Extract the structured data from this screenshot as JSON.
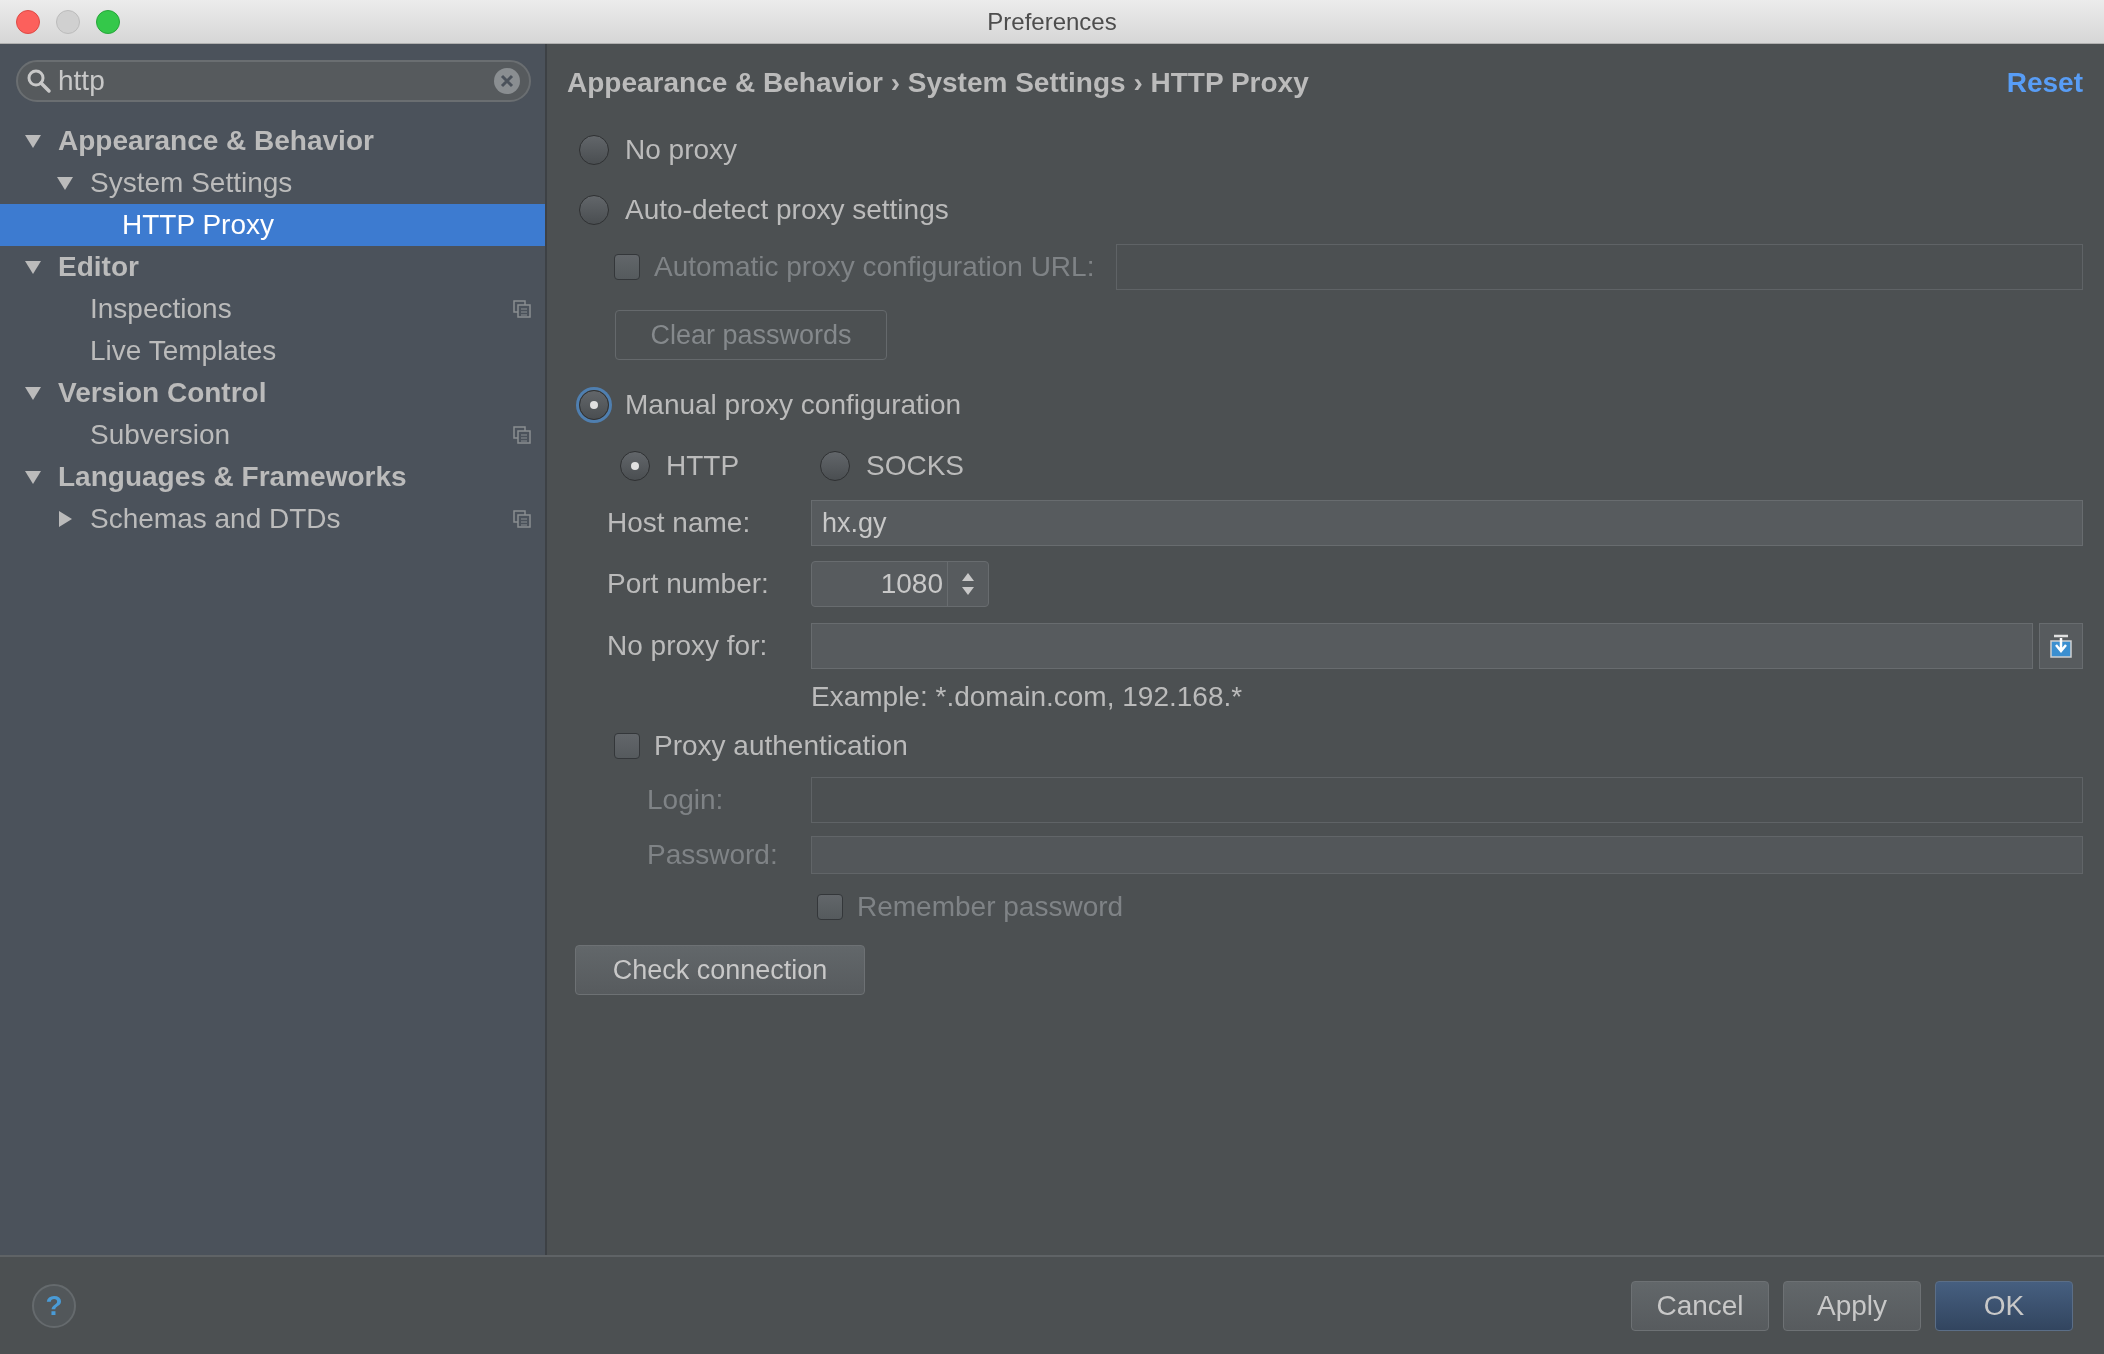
{
  "window": {
    "title": "Preferences"
  },
  "search": {
    "value": "http"
  },
  "tree": [
    {
      "label": "Appearance & Behavior",
      "expanded": true,
      "selected": false,
      "shared": false,
      "children": [
        {
          "label": "System Settings",
          "expanded": true,
          "selected": false,
          "shared": false,
          "children": [
            {
              "label": "HTTP Proxy",
              "selected": true,
              "shared": false
            }
          ]
        }
      ]
    },
    {
      "label": "Editor",
      "expanded": true,
      "selected": false,
      "shared": false,
      "children": [
        {
          "label": "Inspections",
          "selected": false,
          "shared": true
        },
        {
          "label": "Live Templates",
          "selected": false,
          "shared": false
        }
      ]
    },
    {
      "label": "Version Control",
      "expanded": true,
      "selected": false,
      "shared": false,
      "children": [
        {
          "label": "Subversion",
          "selected": false,
          "shared": true
        }
      ]
    },
    {
      "label": "Languages & Frameworks",
      "expanded": true,
      "selected": false,
      "shared": false,
      "children": [
        {
          "label": "Schemas and DTDs",
          "expanded": false,
          "selected": false,
          "shared": true
        }
      ]
    }
  ],
  "breadcrumb": "Appearance & Behavior › System Settings › HTTP Proxy",
  "reset_link": "Reset",
  "no_proxy": {
    "label": "No proxy",
    "selected": false,
    "focused": false
  },
  "auto_detect": {
    "label": "Auto-detect proxy settings",
    "selected": false,
    "focused": false
  },
  "auto_config_url": {
    "label": "Automatic proxy configuration URL:",
    "checked": false,
    "disabled": true
  },
  "clear_passwords_button": {
    "label": "Clear passwords",
    "disabled": true
  },
  "manual": {
    "label": "Manual proxy configuration",
    "selected": true,
    "focused": true
  },
  "protocols": [
    {
      "label": "HTTP",
      "selected": true
    },
    {
      "label": "SOCKS",
      "selected": false
    }
  ],
  "host_name": {
    "label": "Host name:",
    "value": "hx.gy"
  },
  "port_number": {
    "label": "Port number:",
    "value": "1080"
  },
  "no_proxy_for": {
    "label": "No proxy for:"
  },
  "example": "Example: *.domain.com, 192.168.*",
  "proxy_authentication": {
    "label": "Proxy authentication",
    "checked": false,
    "disabled": false
  },
  "login": {
    "label": "Login:",
    "disabled": true
  },
  "password": {
    "label": "Password:",
    "disabled": true
  },
  "remember_password": {
    "label": "Remember password",
    "checked": false,
    "disabled": true
  },
  "check_connection_button": {
    "label": "Check connection",
    "disabled": false
  },
  "help": "?",
  "footer_buttons": [
    {
      "label": "Cancel",
      "default": false
    },
    {
      "label": "Apply",
      "default": false
    },
    {
      "label": "OK",
      "default": true
    }
  ]
}
